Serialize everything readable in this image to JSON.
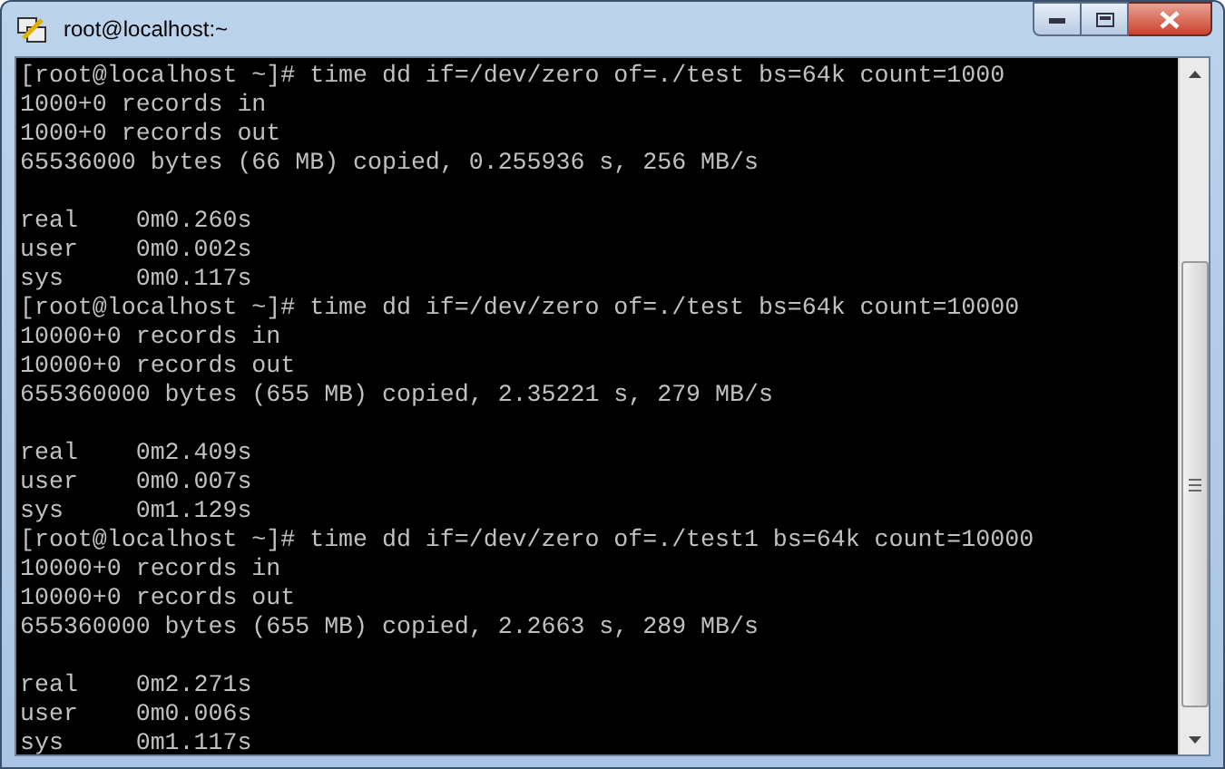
{
  "window": {
    "title": "root@localhost:~"
  },
  "terminal": {
    "blocks": [
      {
        "prompt": "[root@localhost ~]#",
        "command": "time dd if=/dev/zero of=./test bs=64k count=1000",
        "output": [
          "1000+0 records in",
          "1000+0 records out",
          "65536000 bytes (66 MB) copied, 0.255936 s, 256 MB/s"
        ],
        "timing": [
          "real    0m0.260s",
          "user    0m0.002s",
          "sys     0m0.117s"
        ]
      },
      {
        "prompt": "[root@localhost ~]#",
        "command": "time dd if=/dev/zero of=./test bs=64k count=10000",
        "output": [
          "10000+0 records in",
          "10000+0 records out",
          "655360000 bytes (655 MB) copied, 2.35221 s, 279 MB/s"
        ],
        "timing": [
          "real    0m2.409s",
          "user    0m0.007s",
          "sys     0m1.129s"
        ]
      },
      {
        "prompt": "[root@localhost ~]#",
        "command": "time dd if=/dev/zero of=./test1 bs=64k count=10000",
        "output": [
          "10000+0 records in",
          "10000+0 records out",
          "655360000 bytes (655 MB) copied, 2.2663 s, 289 MB/s"
        ],
        "timing": [
          "real    0m2.271s",
          "user    0m0.006s",
          "sys     0m1.117s"
        ]
      }
    ]
  }
}
